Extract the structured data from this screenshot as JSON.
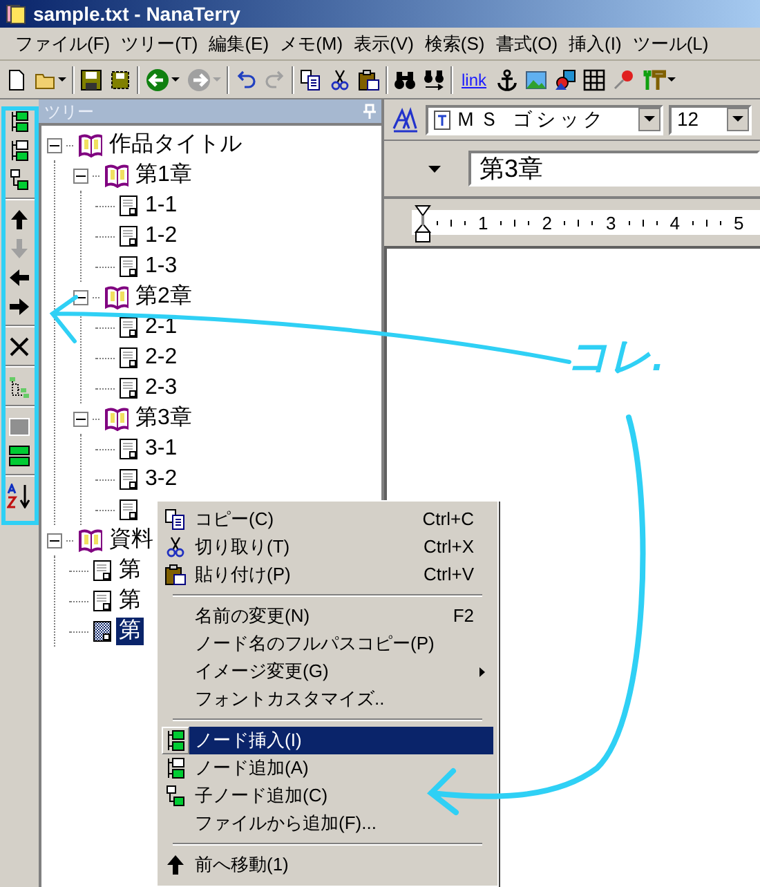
{
  "window": {
    "title": "sample.txt - NanaTerry"
  },
  "menu": [
    "ファイル(F)",
    "ツリー(T)",
    "編集(E)",
    "メモ(M)",
    "表示(V)",
    "検索(S)",
    "書式(O)",
    "挿入(I)",
    "ツール(L)"
  ],
  "toolbar": [
    {
      "kind": "new"
    },
    {
      "kind": "open",
      "dropdown": true
    },
    {
      "kind": "sep"
    },
    {
      "kind": "save"
    },
    {
      "kind": "save-all"
    },
    {
      "kind": "sep"
    },
    {
      "kind": "back",
      "dropdown": true,
      "disabled": false
    },
    {
      "kind": "forward",
      "dropdown": true,
      "disabled": true
    },
    {
      "kind": "sep"
    },
    {
      "kind": "undo",
      "disabled": false
    },
    {
      "kind": "redo",
      "disabled": true
    },
    {
      "kind": "sep"
    },
    {
      "kind": "copy"
    },
    {
      "kind": "cut"
    },
    {
      "kind": "paste"
    },
    {
      "kind": "sep"
    },
    {
      "kind": "find"
    },
    {
      "kind": "replace"
    },
    {
      "kind": "sep"
    },
    {
      "kind": "link",
      "label": "link"
    },
    {
      "kind": "anchor"
    },
    {
      "kind": "image"
    },
    {
      "kind": "shapes"
    },
    {
      "kind": "table"
    },
    {
      "kind": "pin"
    },
    {
      "kind": "tools",
      "dropdown": true
    }
  ],
  "side_toolbar": [
    {
      "kind": "insert-node"
    },
    {
      "kind": "add-node"
    },
    {
      "kind": "add-child"
    },
    {
      "kind": "sep"
    },
    {
      "kind": "up",
      "disabled": false
    },
    {
      "kind": "down",
      "disabled": true
    },
    {
      "kind": "left",
      "disabled": false
    },
    {
      "kind": "right",
      "disabled": false
    },
    {
      "kind": "sep"
    },
    {
      "kind": "delete"
    },
    {
      "kind": "sep"
    },
    {
      "kind": "tree"
    },
    {
      "kind": "sep"
    },
    {
      "kind": "block"
    },
    {
      "kind": "node-bar"
    },
    {
      "kind": "sep"
    },
    {
      "kind": "sort"
    }
  ],
  "tree_panel": {
    "title": "ツリー",
    "nodes": [
      {
        "label": "作品タイトル",
        "kind": "book",
        "expanded": true,
        "selected": false,
        "children": [
          {
            "label": "第1章",
            "kind": "book",
            "expanded": true,
            "selected": false,
            "children": [
              {
                "label": "1-1",
                "kind": "page",
                "selected": false
              },
              {
                "label": "1-2",
                "kind": "page",
                "selected": false
              },
              {
                "label": "1-3",
                "kind": "page",
                "selected": false
              }
            ]
          },
          {
            "label": "第2章",
            "kind": "book",
            "expanded": true,
            "selected": false,
            "children": [
              {
                "label": "2-1",
                "kind": "page",
                "selected": false
              },
              {
                "label": "2-2",
                "kind": "page",
                "selected": false
              },
              {
                "label": "2-3",
                "kind": "page",
                "selected": false
              }
            ]
          },
          {
            "label": "第3章",
            "kind": "book",
            "expanded": true,
            "selected": false,
            "children": [
              {
                "label": "3-1",
                "kind": "page",
                "selected": false
              },
              {
                "label": "3-2",
                "kind": "page",
                "selected": false
              },
              {
                "kind": "page",
                "selected": false
              }
            ]
          }
        ]
      },
      {
        "label": "資料",
        "kind": "book",
        "expanded": true,
        "selected": false,
        "children": [
          {
            "label": "第",
            "kind": "page",
            "selected": false
          },
          {
            "label": "第",
            "kind": "page",
            "selected": false
          },
          {
            "label": "第",
            "kind": "page",
            "selected": true
          }
        ]
      }
    ]
  },
  "format_bar": {
    "font": "ＭＳ ゴシック",
    "size": "12"
  },
  "heading_field": {
    "value": "第3章"
  },
  "ruler": {
    "numbers": [
      "1",
      "2",
      "3",
      "4",
      "5"
    ]
  },
  "context_menu": [
    {
      "kind": "copy",
      "label": "コピー(C)",
      "shortcut": "Ctrl+C",
      "selected": false
    },
    {
      "kind": "cut",
      "label": "切り取り(T)",
      "shortcut": "Ctrl+X",
      "selected": false
    },
    {
      "kind": "paste",
      "label": "貼り付け(P)",
      "shortcut": "Ctrl+V",
      "selected": false
    },
    {
      "kind": "sep"
    },
    {
      "kind": "item",
      "label": "名前の変更(N)",
      "shortcut": "F2",
      "selected": false
    },
    {
      "kind": "item",
      "label": "ノード名のフルパスコピー(P)",
      "selected": false
    },
    {
      "kind": "item",
      "label": "イメージ変更(G)",
      "submenu": true,
      "selected": false
    },
    {
      "kind": "item",
      "label": "フォントカスタマイズ..",
      "selected": false
    },
    {
      "kind": "sep"
    },
    {
      "kind": "insert-node",
      "label": "ノード挿入(I)",
      "selected": true
    },
    {
      "kind": "add-node",
      "label": "ノード追加(A)",
      "selected": false
    },
    {
      "kind": "add-child",
      "label": "子ノード追加(C)",
      "selected": false
    },
    {
      "kind": "item",
      "label": "ファイルから追加(F)...",
      "selected": false
    },
    {
      "kind": "sep"
    },
    {
      "kind": "up",
      "label": "前へ移動(1)",
      "selected": false
    }
  ],
  "annotation": {
    "text": "コレ."
  }
}
